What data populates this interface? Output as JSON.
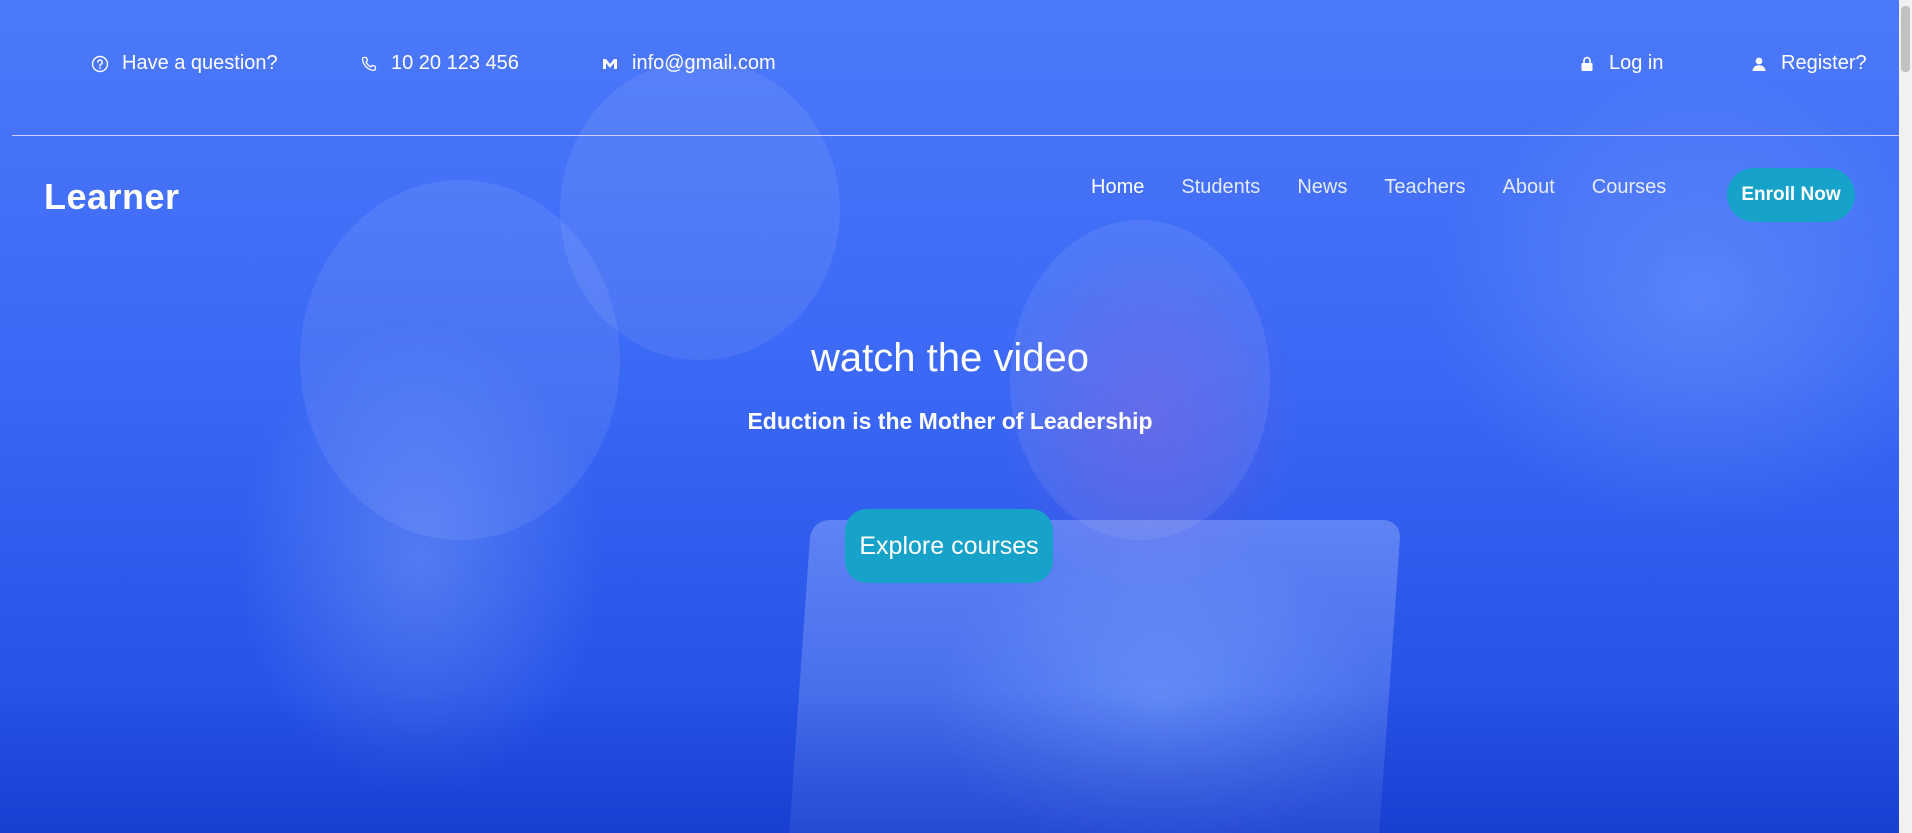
{
  "topbar": {
    "question": "Have a question?",
    "phone": "10 20 123 456",
    "email": "info@gmail.com",
    "login": "Log in",
    "register": "Register?"
  },
  "nav": {
    "logo": "Learner",
    "links": [
      {
        "label": "Home",
        "active": true
      },
      {
        "label": "Students",
        "active": false
      },
      {
        "label": "News",
        "active": false
      },
      {
        "label": "Teachers",
        "active": false
      },
      {
        "label": "About",
        "active": false
      },
      {
        "label": "Courses",
        "active": false
      }
    ],
    "cta": "Enroll Now"
  },
  "hero": {
    "title": "watch the video",
    "subtitle": "Eduction is the Mother of Leadership",
    "button": "Explore courses"
  },
  "colors": {
    "overlay": "#3b68f5",
    "accent": "#17a2c9",
    "text": "#ffffff"
  },
  "icons": {
    "question": "question-circle-icon",
    "phone": "phone-icon",
    "email": "mail-icon",
    "login": "lock-icon",
    "register": "user-icon"
  }
}
